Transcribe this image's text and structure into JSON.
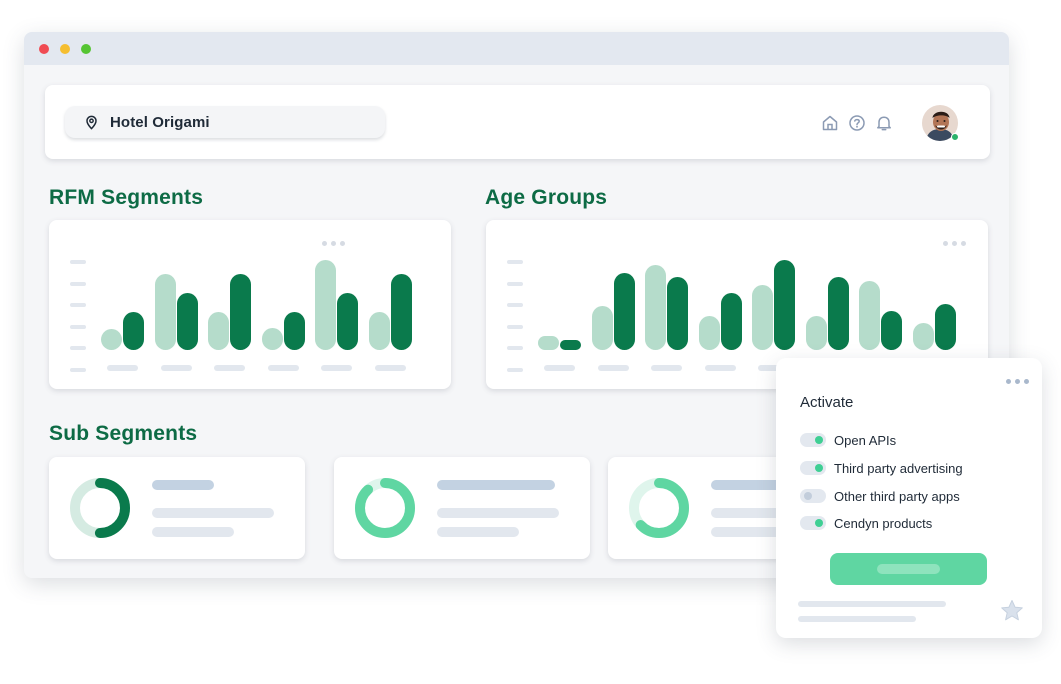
{
  "header": {
    "hotel_name": "Hotel Origami",
    "icons": [
      "map-pin-icon",
      "home-icon",
      "help-icon",
      "bell-icon"
    ]
  },
  "rfm": {
    "title": "RFM Segments",
    "pairs": [
      [
        0.23,
        0.42
      ],
      [
        0.84,
        0.63
      ],
      [
        0.42,
        0.84
      ],
      [
        0.25,
        0.42
      ],
      [
        1.0,
        0.63
      ],
      [
        0.42,
        0.84
      ]
    ]
  },
  "age": {
    "title": "Age Groups",
    "pairs": [
      [
        0.16,
        0.1
      ],
      [
        0.49,
        0.86
      ],
      [
        0.95,
        0.81
      ],
      [
        0.38,
        0.63
      ],
      [
        0.72,
        1.0
      ],
      [
        0.38,
        0.81
      ],
      [
        0.77,
        0.43
      ],
      [
        0.3,
        0.51
      ]
    ]
  },
  "sub": {
    "title": "Sub Segments",
    "donuts": [
      {
        "fraction": 0.5,
        "accent": "#0a7a4c",
        "track": "#d5ebe2"
      },
      {
        "fraction": 0.88,
        "accent": "#5fd6a2",
        "track": "#dff5ec"
      },
      {
        "fraction": 0.63,
        "accent": "#5fd6a2",
        "track": "#dff5ec"
      }
    ]
  },
  "activate": {
    "title": "Activate",
    "options": [
      {
        "label": "Open APIs",
        "on": true
      },
      {
        "label": "Third party advertising",
        "on": true
      },
      {
        "label": "Other third party apps",
        "on": false
      },
      {
        "label": "Cendyn products",
        "on": true
      }
    ]
  },
  "colors": {
    "accent_dark": "#0a7a4c",
    "accent_light": "#b5dccb",
    "accent_mint": "#5fd6a2",
    "title_green": "#0d6b45"
  }
}
